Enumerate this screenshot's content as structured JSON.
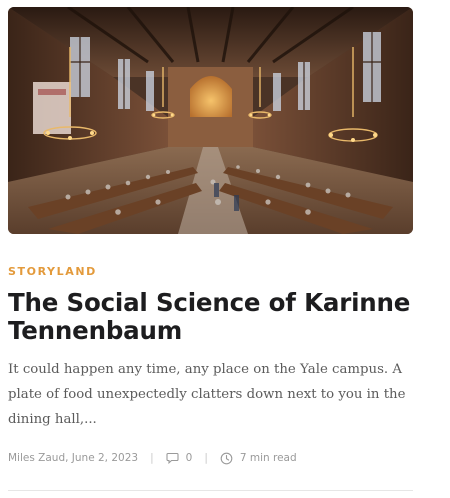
{
  "post": {
    "category": "STORYLAND",
    "title": "The Social Science of Karinne Tennenbaum",
    "excerpt": "It could happen any time, any place on the Yale campus. A plate of food unexpectedly clatters down next to you in the dining hall,...",
    "author": "Miles Zaud",
    "date": "June 2, 2023",
    "comments": "0",
    "read_time": "7 min read",
    "image_icon": "dining-hall-photo"
  },
  "colors": {
    "category": "#e39a3b",
    "title": "#1d1d1f",
    "excerpt": "#5b5b5b",
    "meta": "#9a9a9a"
  },
  "icons": {
    "comments": "comment-bubble-icon",
    "read_time": "clock-icon"
  }
}
